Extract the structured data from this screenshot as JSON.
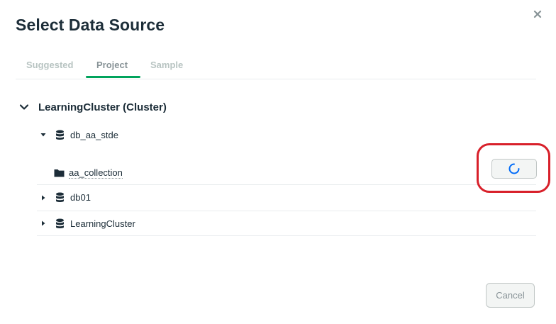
{
  "dialog": {
    "title": "Select Data Source",
    "close_icon": "close-icon"
  },
  "tabs": [
    {
      "label": "Suggested",
      "active": false
    },
    {
      "label": "Project",
      "active": true
    },
    {
      "label": "Sample",
      "active": false
    }
  ],
  "tree": {
    "cluster": {
      "label": "LearningCluster (Cluster)",
      "expanded": true
    },
    "databases": [
      {
        "label": "db_aa_stde",
        "expanded": true,
        "collections": [
          {
            "label": "aa_collection",
            "action_state": "loading"
          }
        ]
      },
      {
        "label": "db01",
        "expanded": false
      },
      {
        "label": "LearningCluster",
        "expanded": false
      }
    ]
  },
  "footer": {
    "cancel_label": "Cancel"
  },
  "colors": {
    "accent": "#00a35c",
    "text": "#1c2d38",
    "muted": "#b8c4c2",
    "spinner": "#016bf8",
    "highlight": "#d8202a"
  }
}
